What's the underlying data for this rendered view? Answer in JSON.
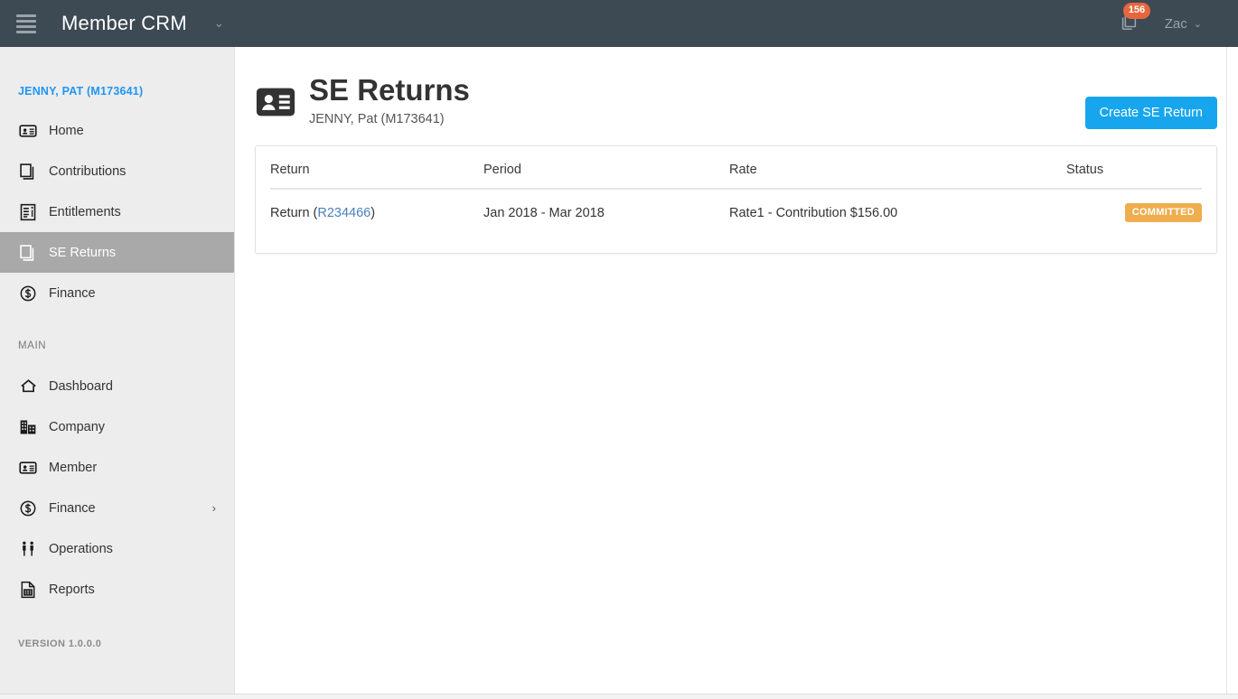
{
  "topbar": {
    "menu_icon": "hamburger-icon",
    "brand": "Member CRM",
    "brand_caret": "⌄",
    "notifications": {
      "icon": "copy-documents-icon",
      "count": "156"
    },
    "user": {
      "name": "Zac",
      "caret": "⌄"
    }
  },
  "sidebar": {
    "context_member": "JENNY, PAT (M173641)",
    "context_items": [
      {
        "label": "Home",
        "icon": "id-card-icon",
        "active": false
      },
      {
        "label": "Contributions",
        "icon": "copy-documents-icon",
        "active": false
      },
      {
        "label": "Entitlements",
        "icon": "document-list-icon",
        "active": false
      },
      {
        "label": "SE Returns",
        "icon": "copy-documents-icon",
        "active": true
      },
      {
        "label": "Finance",
        "icon": "dollar-circle-icon",
        "active": false
      }
    ],
    "group_title": "MAIN",
    "main_items": [
      {
        "label": "Dashboard",
        "icon": "home-icon",
        "chevron": ""
      },
      {
        "label": "Company",
        "icon": "building-icon",
        "chevron": ""
      },
      {
        "label": "Member",
        "icon": "id-card-icon",
        "chevron": ""
      },
      {
        "label": "Finance",
        "icon": "dollar-circle-icon",
        "chevron": "›"
      },
      {
        "label": "Operations",
        "icon": "people-icon",
        "chevron": ""
      },
      {
        "label": "Reports",
        "icon": "report-grid-icon",
        "chevron": ""
      }
    ],
    "version": "VERSION 1.0.0.0"
  },
  "page": {
    "icon": "id-card-icon",
    "title": "SE Returns",
    "subtitle": "JENNY, Pat (M173641)",
    "create_button": "Create SE Return"
  },
  "table": {
    "headers": {
      "return": "Return",
      "period": "Period",
      "rate": "Rate",
      "status": "Status"
    },
    "rows": [
      {
        "return_prefix": "Return (",
        "return_link": "R234466",
        "return_suffix": ")",
        "period": "Jan 2018 - Mar 2018",
        "rate": "Rate1 - Contribution $156.00",
        "status": "COMMITTED"
      }
    ]
  },
  "colors": {
    "topbar_bg": "#3d4a54",
    "sidebar_bg": "#ededed",
    "active_item_bg": "#a9a9a9",
    "accent_blue": "#17a6ee",
    "member_link_blue": "#2196f3",
    "row_link_blue": "#4a7fbd",
    "badge_committed": "#efad4e",
    "notification_badge": "#e8663c"
  }
}
